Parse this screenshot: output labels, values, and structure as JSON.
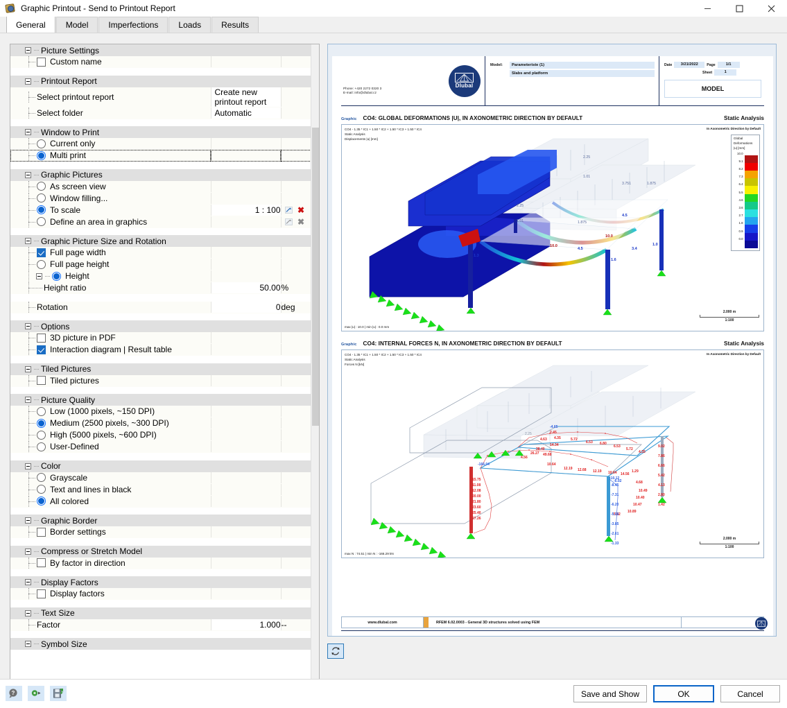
{
  "window": {
    "title": "Graphic Printout - Send to Printout Report",
    "icon": "printout-icon",
    "minimize": "minimize-icon",
    "maximize": "maximize-icon",
    "close": "close-icon"
  },
  "tabs": [
    {
      "label": "General",
      "active": true
    },
    {
      "label": "Model",
      "active": false
    },
    {
      "label": "Imperfections",
      "active": false
    },
    {
      "label": "Loads",
      "active": false
    },
    {
      "label": "Results",
      "active": false
    }
  ],
  "settings": {
    "groups": [
      {
        "name": "Picture Settings",
        "rows": [
          {
            "type": "checkbox",
            "label": "Custom name",
            "checked": false,
            "value": "",
            "unit": ""
          }
        ]
      },
      {
        "name": "Printout Report",
        "rows": [
          {
            "type": "plain",
            "label": "Select printout report",
            "value": "Create new printout report",
            "unit": "",
            "valueAlign": "left"
          },
          {
            "type": "plain",
            "label": "Select folder",
            "value": "Automatic",
            "unit": "",
            "valueAlign": "left"
          }
        ]
      },
      {
        "name": "Window to Print",
        "rows": [
          {
            "type": "radio",
            "label": "Current only",
            "checked": false,
            "value": "",
            "unit": ""
          },
          {
            "type": "radio",
            "label": "Multi print",
            "checked": true,
            "focused": true,
            "value": "",
            "unit": ""
          }
        ]
      },
      {
        "name": "Graphic Pictures",
        "rows": [
          {
            "type": "radio",
            "label": "As screen view",
            "checked": false,
            "value": "",
            "unit": ""
          },
          {
            "type": "radio",
            "label": "Window filling...",
            "checked": false,
            "value": "",
            "unit": ""
          },
          {
            "type": "radio",
            "label": "To scale",
            "checked": true,
            "value": "1 : 100",
            "unit": "",
            "buttons": "active"
          },
          {
            "type": "radio",
            "label": "Define an area in graphics",
            "checked": false,
            "value": "",
            "unit": "",
            "buttons": "dim"
          }
        ]
      },
      {
        "name": "Graphic Picture Size and Rotation",
        "rows": [
          {
            "type": "checkbox",
            "label": "Full page width",
            "checked": true,
            "value": "",
            "unit": ""
          },
          {
            "type": "radio",
            "label": "Full page height",
            "checked": false,
            "value": "",
            "unit": ""
          },
          {
            "type": "radio",
            "label": "Height",
            "checked": true,
            "value": "",
            "unit": "",
            "expander": true
          },
          {
            "type": "plain",
            "label": "Height ratio",
            "value": "50.00",
            "unit": "%",
            "indent": "deep"
          },
          {
            "type": "plain",
            "label": "Rotation",
            "value": "0",
            "unit": "deg",
            "gapBefore": true
          }
        ]
      },
      {
        "name": "Options",
        "rows": [
          {
            "type": "checkbox",
            "label": "3D picture in PDF",
            "checked": false,
            "value": "",
            "unit": ""
          },
          {
            "type": "checkbox",
            "label": "Interaction diagram | Result table",
            "checked": true,
            "value": "",
            "unit": ""
          }
        ]
      },
      {
        "name": "Tiled Pictures",
        "rows": [
          {
            "type": "checkbox",
            "label": "Tiled pictures",
            "checked": false,
            "value": "",
            "unit": ""
          }
        ]
      },
      {
        "name": "Picture Quality",
        "rows": [
          {
            "type": "radio",
            "label": "Low (1000 pixels, ~150 DPI)",
            "checked": false,
            "value": "",
            "unit": ""
          },
          {
            "type": "radio",
            "label": "Medium (2500 pixels, ~300 DPI)",
            "checked": true,
            "value": "",
            "unit": ""
          },
          {
            "type": "radio",
            "label": "High (5000 pixels, ~600 DPI)",
            "checked": false,
            "value": "",
            "unit": ""
          },
          {
            "type": "radio",
            "label": "User-Defined",
            "checked": false,
            "value": "",
            "unit": ""
          }
        ]
      },
      {
        "name": "Color",
        "rows": [
          {
            "type": "radio",
            "label": "Grayscale",
            "checked": false,
            "value": "",
            "unit": ""
          },
          {
            "type": "radio",
            "label": "Text and lines in black",
            "checked": false,
            "value": "",
            "unit": ""
          },
          {
            "type": "radio",
            "label": "All colored",
            "checked": true,
            "value": "",
            "unit": ""
          }
        ]
      },
      {
        "name": "Graphic Border",
        "rows": [
          {
            "type": "checkbox",
            "label": "Border settings",
            "checked": false,
            "value": "",
            "unit": ""
          }
        ]
      },
      {
        "name": "Compress or Stretch Model",
        "rows": [
          {
            "type": "checkbox",
            "label": "By factor in direction",
            "checked": false,
            "value": "",
            "unit": ""
          }
        ]
      },
      {
        "name": "Display Factors",
        "rows": [
          {
            "type": "checkbox",
            "label": "Display factors",
            "checked": false,
            "value": "",
            "unit": ""
          }
        ]
      },
      {
        "name": "Text Size",
        "rows": [
          {
            "type": "plain",
            "label": "Factor",
            "value": "1.000",
            "unit": "--"
          }
        ]
      },
      {
        "name": "Symbol Size",
        "rows": []
      }
    ]
  },
  "preview": {
    "refresh_icon": "refresh-icon",
    "document": {
      "header": {
        "phone": "Phone: +420 2272 0320 3",
        "email": "E-mail: info@dlubal.cz",
        "logo_text": "Dlubal",
        "model_label": "Model:",
        "model_name": "Parameteriste (1)",
        "model_desc": "Slabs and platform",
        "date_label": "Date",
        "date_value": "3/21/2022",
        "page_label": "Page",
        "page_value": "1/1",
        "sheet_label": "Sheet",
        "sheet_value": "1",
        "doc_kind": "MODEL"
      },
      "graphics": [
        {
          "tag": "Graphic",
          "title": "CO4: GLOBAL DEFORMATIONS |U|, IN AXONOMETRIC DIRECTION BY DEFAULT",
          "analysis": "Static Analysis",
          "meta_lines": [
            "CO4 - 1.35 * IC1 + 1.50 * IC2 + 1.50 * IC3 + 1.50 * IC4",
            "Static Analysis",
            "Displacements |u| [mm]"
          ],
          "meta_right": "In Axonometric Direction by Default",
          "footer": "max |u| : 10.0 | min |u| : 0.0 mm",
          "scale_value": "2.000 m",
          "scale_ratio": "1:100",
          "legend": {
            "title_lines": [
              "Global",
              "Deformations",
              "|u| [mm]"
            ],
            "labels": [
              "10.0",
              "9.1",
              "8.2",
              "7.3",
              "6.4",
              "5.5",
              "4.6",
              "3.6",
              "2.7",
              "1.8",
              "0.9",
              "0.0"
            ],
            "colors": [
              "#b11414",
              "#f00000",
              "#f5a300",
              "#c8c400",
              "#f7f100",
              "#23d723",
              "#14c98a",
              "#2ae0e0",
              "#23a5ef",
              "#1640ea",
              "#1616c8",
              "#0b0b96"
            ]
          },
          "annotations": [
            "2.25",
            "1.01",
            "3.751",
            "1.875",
            "2.25",
            "1.01",
            "1.875",
            "4.5",
            "10.0",
            "10.0",
            "3.4",
            "1.0",
            "1.3",
            "4.5",
            "1.6"
          ]
        },
        {
          "tag": "Graphic",
          "title": "CO4: INTERNAL FORCES N, IN AXONOMETRIC DIRECTION BY DEFAULT",
          "analysis": "Static Analysis",
          "meta_lines": [
            "CO4 - 1.35 * IC1 + 1.50 * IC2 + 1.50 * IC3 + 1.50 * IC4",
            "Static Analysis",
            "Forces N [kN]"
          ],
          "meta_right": "In Axonometric Direction by Default",
          "footer": "max N : 74.51 | min N : -166.29 kN",
          "scale_value": "2.000 m",
          "scale_ratio": "1:100",
          "annotations_red": [
            "4.65",
            "4.35",
            "5.72",
            "6.53",
            "6.80",
            "6.53",
            "5.72",
            "4.35",
            "2.45",
            "14.34",
            "26.27",
            "10.64",
            "12.19",
            "12.68",
            "12.19",
            "10.64",
            "4.56",
            "9.02",
            "7.86",
            "6.66",
            "5.42",
            "4.13",
            "2.80",
            "1.42",
            "4.68",
            "10.49",
            "10.40",
            "10.47",
            "10.89",
            "5.02",
            "14.56",
            "1.29"
          ],
          "annotations_blue": [
            "-4.65",
            "-7.31",
            "-6.20",
            "-5.06",
            "-3.85",
            "-2.61",
            "-1.33",
            "-166.04",
            "-10.12",
            "-6.02",
            "-8.45"
          ]
        }
      ],
      "footer": {
        "website": "www.dlubal.com",
        "program": "RFEM 6.02.0003 - General 3D structures solved using FEM",
        "logo": "dlubal-logo-icon"
      }
    }
  },
  "bottom_bar": {
    "tools": [
      {
        "name": "help-icon",
        "glyph": "?"
      },
      {
        "name": "settings-export-icon",
        "glyph": ""
      },
      {
        "name": "save-settings-icon",
        "glyph": ""
      }
    ],
    "buttons": [
      {
        "label": "Save and Show",
        "primary": false
      },
      {
        "label": "OK",
        "primary": true
      },
      {
        "label": "Cancel",
        "primary": false
      }
    ]
  }
}
